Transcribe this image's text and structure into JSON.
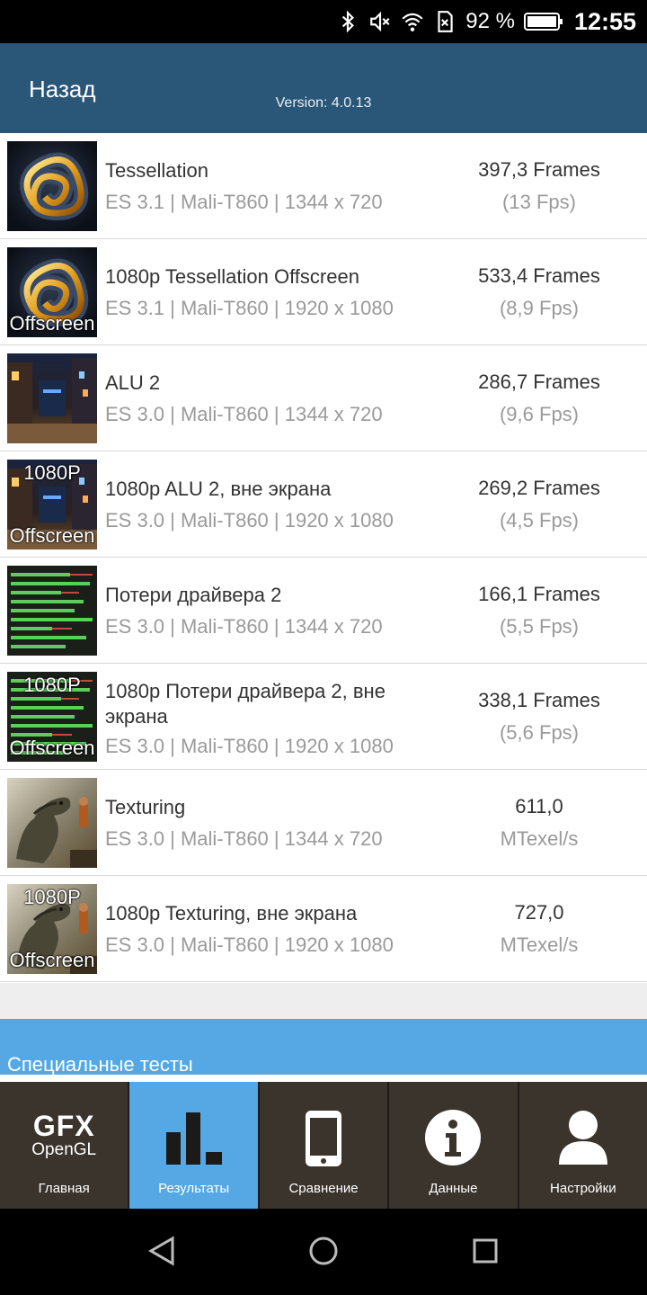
{
  "status_bar": {
    "battery_percent": "92 %",
    "time": "12:55",
    "icons": [
      "bluetooth-icon",
      "mute-icon",
      "wifi-icon",
      "no-sim-icon",
      "battery-icon"
    ]
  },
  "header": {
    "back_label": "Назад",
    "version": "Version: 4.0.13"
  },
  "results": [
    {
      "title": "Tessellation",
      "subtitle": "ES 3.1 | Mali-T860 | 1344 x 720",
      "value": "397,3 Frames",
      "unit": "(13 Fps)",
      "thumb": "tessellation",
      "top_label": "",
      "bottom_label": ""
    },
    {
      "title": "1080p Tessellation Offscreen",
      "subtitle": "ES 3.1 | Mali-T860 | 1920 x 1080",
      "value": "533,4 Frames",
      "unit": "(8,9 Fps)",
      "thumb": "tessellation",
      "top_label": "",
      "bottom_label": "Offscreen"
    },
    {
      "title": "ALU 2",
      "subtitle": "ES 3.0 | Mali-T860 | 1344 x 720",
      "value": "286,7 Frames",
      "unit": "(9,6 Fps)",
      "thumb": "alu",
      "top_label": "",
      "bottom_label": ""
    },
    {
      "title": "1080p ALU 2, вне экрана",
      "subtitle": "ES 3.0 | Mali-T860 | 1920 x 1080",
      "value": "269,2 Frames",
      "unit": "(4,5 Fps)",
      "thumb": "alu",
      "top_label": "1080P",
      "bottom_label": "Offscreen"
    },
    {
      "title": "Потери драйвера 2",
      "subtitle": "ES 3.0 | Mali-T860 | 1344 x 720",
      "value": "166,1 Frames",
      "unit": "(5,5 Fps)",
      "thumb": "driver",
      "top_label": "",
      "bottom_label": ""
    },
    {
      "title": "1080p Потери драйвера 2, вне экрана",
      "subtitle": "ES 3.0 | Mali-T860 | 1920 x 1080",
      "value": "338,1 Frames",
      "unit": "(5,6 Fps)",
      "thumb": "driver",
      "top_label": "1080P",
      "bottom_label": "Offscreen"
    },
    {
      "title": "Texturing",
      "subtitle": "ES 3.0 | Mali-T860 | 1344 x 720",
      "value": "611,0",
      "unit": "MTexel/s",
      "thumb": "texturing",
      "top_label": "",
      "bottom_label": ""
    },
    {
      "title": "1080p Texturing, вне экрана",
      "subtitle": "ES 3.0 | Mali-T860 | 1920 x 1080",
      "value": "727,0",
      "unit": "MTexel/s",
      "thumb": "texturing",
      "top_label": "1080P",
      "bottom_label": "Offscreen"
    }
  ],
  "section": {
    "title": "Специальные тесты"
  },
  "tabs": [
    {
      "label": "Главная",
      "icon": "gfx-opengl-logo-icon",
      "logo_big": "GFX",
      "logo_small": "OpenGL",
      "active": false
    },
    {
      "label": "Результаты",
      "icon": "bar-chart-icon",
      "active": true
    },
    {
      "label": "Сравнение",
      "icon": "phone-icon",
      "active": false
    },
    {
      "label": "Данные",
      "icon": "info-icon",
      "active": false
    },
    {
      "label": "Настройки",
      "icon": "user-icon",
      "active": false
    }
  ],
  "nav": {
    "icons": [
      "back-triangle-icon",
      "home-circle-icon",
      "recents-square-icon"
    ]
  },
  "colors": {
    "header_bg": "#2a5677",
    "accent_blue": "#55a8e4",
    "tab_bg": "#3b342d"
  }
}
